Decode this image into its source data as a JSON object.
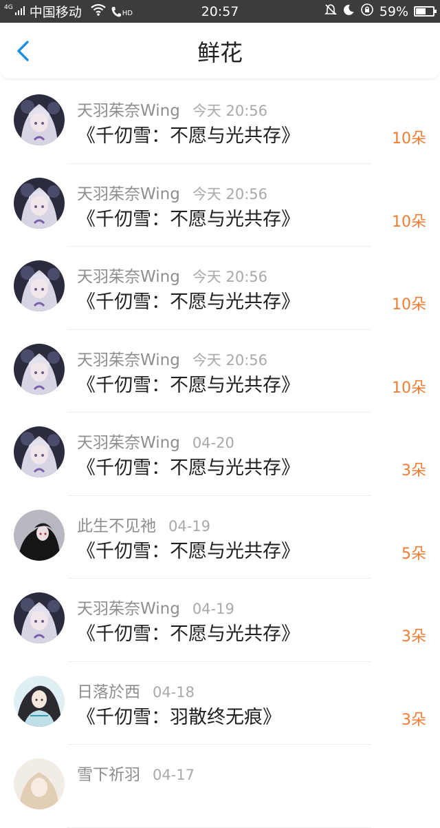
{
  "status_bar": {
    "network": "4G",
    "carrier": "中国移动",
    "hd": "HD",
    "time": "20:57",
    "battery_text": "59%",
    "battery_level": 0.59
  },
  "header": {
    "title": "鲜花",
    "back_icon": "chevron-left-icon"
  },
  "colors": {
    "accent": "#1a8fe3",
    "count": "#f07c33",
    "statusbar": "#3c3c3c"
  },
  "items": [
    {
      "user": "天羽茱奈Wing",
      "time": "今天 20:56",
      "book": "《千仞雪：不愿与光共存》",
      "count": "10朵",
      "avatar": "anime-girl-white-hair"
    },
    {
      "user": "天羽茱奈Wing",
      "time": "今天 20:56",
      "book": "《千仞雪：不愿与光共存》",
      "count": "10朵",
      "avatar": "anime-girl-white-hair"
    },
    {
      "user": "天羽茱奈Wing",
      "time": "今天 20:56",
      "book": "《千仞雪：不愿与光共存》",
      "count": "10朵",
      "avatar": "anime-girl-white-hair"
    },
    {
      "user": "天羽茱奈Wing",
      "time": "今天 20:56",
      "book": "《千仞雪：不愿与光共存》",
      "count": "10朵",
      "avatar": "anime-girl-white-hair"
    },
    {
      "user": "天羽茱奈Wing",
      "time": "04-20",
      "book": "《千仞雪：不愿与光共存》",
      "count": "3朵",
      "avatar": "anime-girl-white-hair"
    },
    {
      "user": "此生不见祂",
      "time": "04-19",
      "book": "《千仞雪：不愿与光共存》",
      "count": "5朵",
      "avatar": "dark-character"
    },
    {
      "user": "天羽茱奈Wing",
      "time": "04-19",
      "book": "《千仞雪：不愿与光共存》",
      "count": "3朵",
      "avatar": "anime-girl-white-hair"
    },
    {
      "user": "日落於西",
      "time": "04-18",
      "book": "《千仞雪：羽散终无痕》",
      "count": "3朵",
      "avatar": "ancient-style-character"
    },
    {
      "user": "雪下祈羽",
      "time": "04-17",
      "book": "",
      "count": "",
      "avatar": "light-hair-character"
    }
  ]
}
